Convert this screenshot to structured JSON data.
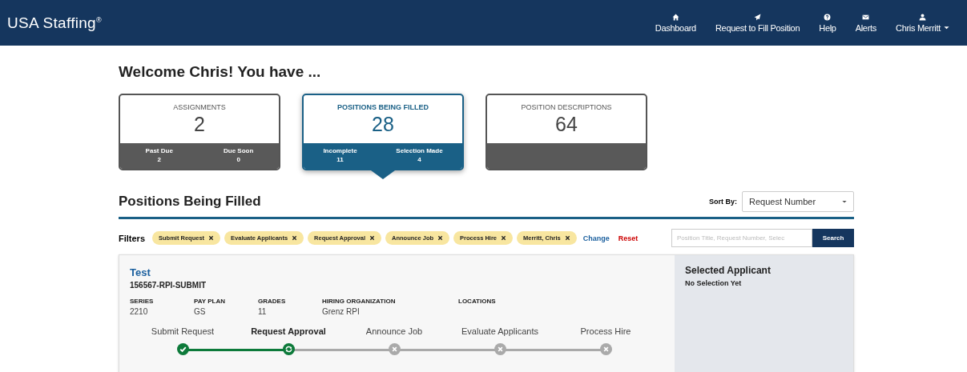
{
  "header": {
    "logo": "USA Staffing$^{®}$",
    "nav": [
      {
        "label": "Dashboard"
      },
      {
        "label": "Request to Fill Position"
      },
      {
        "label": "Help"
      },
      {
        "label": "Alerts"
      },
      {
        "label": "Chris Merritt",
        "dropdown": true
      }
    ]
  },
  "welcome": "Welcome Chris! You have ...",
  "cards": [
    {
      "title": "ASSIGNMENTS",
      "count": "2",
      "selected": false,
      "stats": [
        {
          "label": "Past Due",
          "value": "2"
        },
        {
          "label": "Due Soon",
          "value": "0"
        }
      ]
    },
    {
      "title": "POSITIONS BEING FILLED",
      "count": "28",
      "selected": true,
      "stats": [
        {
          "label": "Incomplete",
          "value": "11"
        },
        {
          "label": "Selection Made",
          "value": "4"
        }
      ]
    },
    {
      "title": "POSITION DESCRIPTIONS",
      "count": "64",
      "selected": false
    }
  ],
  "section": {
    "title": "Positions Being Filled",
    "sort_label": "Sort By:",
    "sort_value": "Request Number"
  },
  "filters": {
    "label": "Filters",
    "chips": [
      "Submit Request",
      "Evaluate Applicants",
      "Request Approval",
      "Announce Job",
      "Process Hire",
      "Merritt, Chris"
    ],
    "change": "Change",
    "reset": "Reset",
    "search_placeholder": "Position Title, Request Number, Selec",
    "search_button": "Search"
  },
  "position": {
    "title": "Test",
    "number": "156567-RPI-SUBMIT",
    "fields": [
      {
        "label": "SERIES",
        "value": "2210"
      },
      {
        "label": "PAY PLAN",
        "value": "GS"
      },
      {
        "label": "GRADES",
        "value": "11"
      },
      {
        "label": "HIRING ORGANIZATION",
        "value": "Grenz RPI"
      },
      {
        "label": "LOCATIONS"
      }
    ],
    "steps": [
      {
        "label": "Submit Request",
        "kind": "done"
      },
      {
        "label": "Request Approval",
        "kind": "current"
      },
      {
        "label": "Announce Job",
        "kind": "pending"
      },
      {
        "label": "Evaluate Applicants",
        "kind": "pending"
      },
      {
        "label": "Process Hire",
        "kind": "pending"
      }
    ],
    "side_title": "Selected Applicant",
    "side_text": "No Selection Yet"
  }
}
